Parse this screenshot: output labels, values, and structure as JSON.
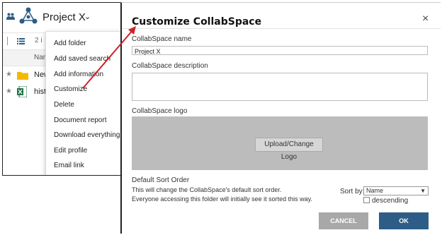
{
  "app": {
    "project_title": "Project X",
    "count_text": "2 i",
    "column_name": "Nar",
    "rows": [
      {
        "label": "New",
        "icon": "folder-icon"
      },
      {
        "label": "hist",
        "icon": "excel-file-icon"
      }
    ]
  },
  "menu": {
    "items": [
      "Add folder",
      "Add saved search",
      "Add information",
      "Customize",
      "Delete",
      "Document report",
      "Download everything",
      "Edit profile",
      "Email link"
    ]
  },
  "dialog": {
    "title": "Customize CollabSpace",
    "close": "×",
    "name_label": "CollabSpace name",
    "name_value": "Project X",
    "description_label": "CollabSpace description",
    "description_value": "",
    "logo_label": "CollabSpace logo",
    "upload_button": "Upload/Change Logo",
    "sort_heading": "Default Sort Order",
    "sort_desc_line1": "This will change the CollabSpace's default sort order.",
    "sort_desc_line2": "Everyone accessing this folder will initially see it sorted this way.",
    "sort_by_label": "Sort by:",
    "sort_by_value": "Name",
    "descending_label": "descending",
    "descending_checked": false,
    "cancel_button": "CANCEL",
    "ok_button": "OK"
  },
  "colors": {
    "ok_button": "#2d5d86",
    "cancel_button": "#a8a8a8",
    "annotation_arrow": "#d0202a",
    "logo_area": "#bcbcbc"
  }
}
